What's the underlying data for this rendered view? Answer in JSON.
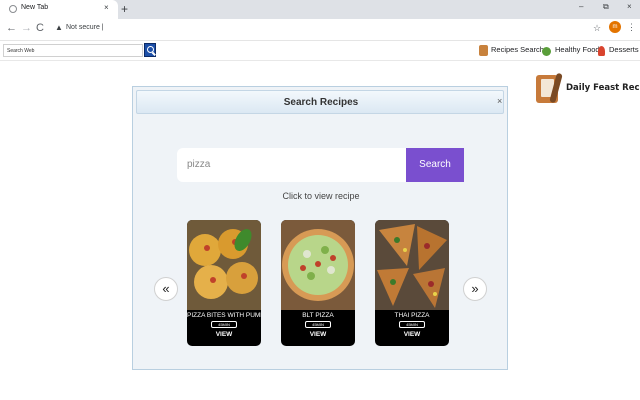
{
  "browser": {
    "tab_title": "New Tab",
    "tab_close": "×",
    "new_tab": "+",
    "window_controls": [
      "–",
      "⧉",
      "×"
    ],
    "nav": [
      "←",
      "→",
      "C"
    ],
    "security_label": "Not secure |",
    "star": "☆",
    "profile_initial": "m",
    "menu": "⋮"
  },
  "bookmarks": {
    "search_placeholder": "Search Web",
    "items": [
      {
        "label": "Recipes Search",
        "color": "#c8823d"
      },
      {
        "label": "Healthy Food",
        "color": "#5a9e3a"
      },
      {
        "label": "Desserts",
        "color": "#d9442e"
      }
    ]
  },
  "brand": {
    "name": "Daily Feast Recipe"
  },
  "panel": {
    "title": "Search Recipes",
    "close": "×",
    "search_value": "pizza",
    "search_button": "Search",
    "hint": "Click to view recipe",
    "prev": "«",
    "next": "»",
    "recipes": [
      {
        "title": "PIZZA BITES WITH PUMP",
        "time": "45MIN",
        "view": "VIEW"
      },
      {
        "title": "BLT PIZZA",
        "time": "45MIN",
        "view": "VIEW"
      },
      {
        "title": "THAI PIZZA",
        "time": "45MIN",
        "view": "VIEW"
      }
    ]
  },
  "colors": {
    "accent": "#7a4fcf",
    "panel_bg": "#eff3f7",
    "panel_border": "#b9cfe0"
  }
}
